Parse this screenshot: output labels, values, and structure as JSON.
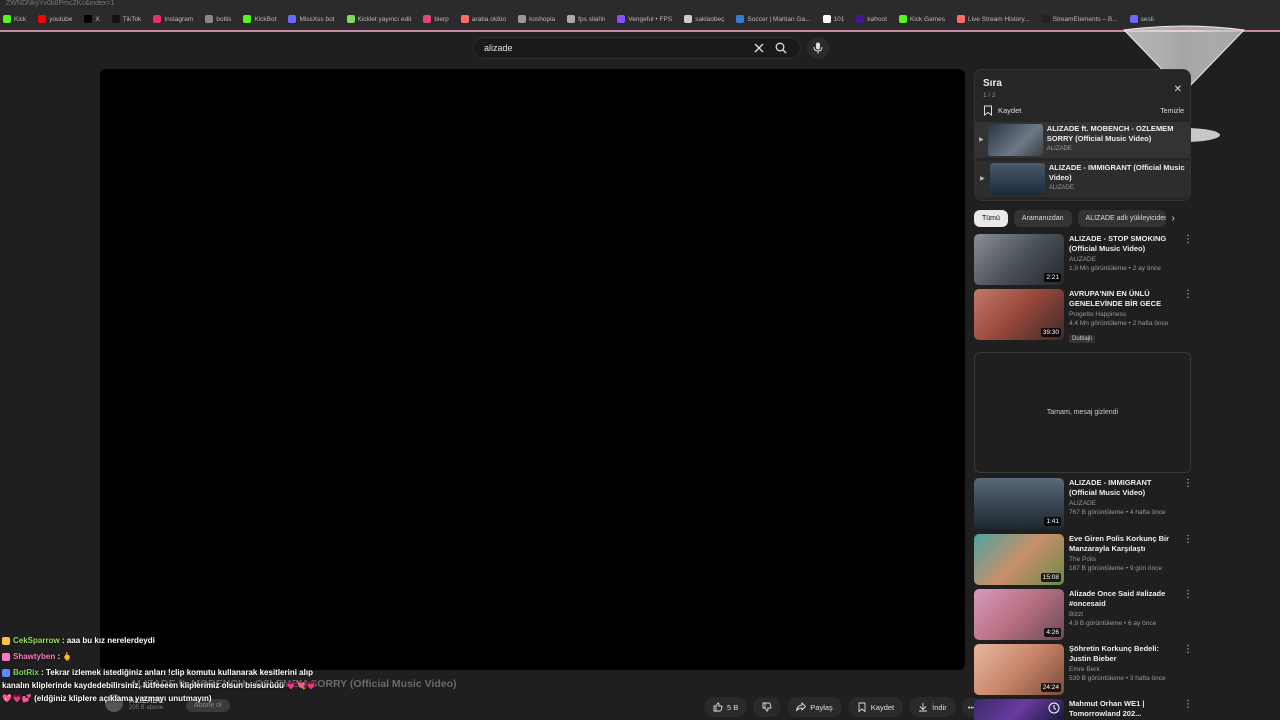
{
  "browser": {
    "url_fragment": "ZWNDNkyYv0b8PmcZKc&index=1",
    "bookmarks": [
      {
        "label": "Kick",
        "color": "#53fc18"
      },
      {
        "label": "youtube",
        "color": "#ff0000"
      },
      {
        "label": "X",
        "color": "#000000"
      },
      {
        "label": "TikTok",
        "color": "#111111"
      },
      {
        "label": "Instagram",
        "color": "#e1306c"
      },
      {
        "label": "botlis",
        "color": "#888888"
      },
      {
        "label": "KickBot",
        "color": "#53fc18"
      },
      {
        "label": "MissXss bot",
        "color": "#6a6aff"
      },
      {
        "label": "Kicklet yayıncı edit",
        "color": "#7ddc5c"
      },
      {
        "label": "bierp",
        "color": "#e0457b"
      },
      {
        "label": "araba oldüo",
        "color": "#ff6b6b"
      },
      {
        "label": "koshopia",
        "color": "#999999"
      },
      {
        "label": "fps silahlı",
        "color": "#aaaaaa"
      },
      {
        "label": "Vengeful • FPS",
        "color": "#8a4fff"
      },
      {
        "label": "saklaobeç",
        "color": "#cccccc"
      },
      {
        "label": "Soccer | Martian Ga...",
        "color": "#3a7bd5"
      },
      {
        "label": "101",
        "color": "#ffffff"
      },
      {
        "label": "kahoot",
        "color": "#46178f"
      },
      {
        "label": "Kick Games",
        "color": "#53fc18"
      },
      {
        "label": "Live Stream History...",
        "color": "#ff6b6b"
      },
      {
        "label": "StreamElements – B...",
        "color": "#222222"
      },
      {
        "label": "sesli",
        "color": "#6a6aff"
      }
    ]
  },
  "search": {
    "value": "alizade"
  },
  "video": {
    "title": "ALIZADE ft. MOBENCH - OZLEMEM SORRY (Official Music Video)",
    "channel": "ALIZADE",
    "subscribers": "205 B abone",
    "subscribe_label": "Abone ol",
    "likes": "5 B",
    "share_label": "Paylaş",
    "save_label": "Kaydet",
    "download_label": "İndir"
  },
  "chat": {
    "messages": [
      {
        "user": "CekSparrow",
        "text": ": aaa bu kız nerelerdeydi"
      },
      {
        "user": "Shawtyben",
        "text": ": 🖕"
      },
      {
        "user": "BotRix",
        "text": ": Tekrar izlemek istediğiniz anları !clip komutu kullanarak kesitlerini alıp kanalın kliplerinde kaydedebilirsiniz, lütfeeeen kliplerimiz olsun bissürüüü 💗💘💗💖💗💕 (eldğiniz kliplere açıklama yazmayı unutmayın)"
      }
    ]
  },
  "queue": {
    "title": "Sıra",
    "count": "1 / 2",
    "save_label": "Kaydet",
    "clear_label": "Temizle",
    "items": [
      {
        "title": "ALIZADE ft. MOBENCH - OZLEMEM SORRY (Official Music Video)",
        "channel": "ALIZADE"
      },
      {
        "title": "ALIZADE - IMMIGRANT (Official Music Video)",
        "channel": "ALIZADE"
      }
    ]
  },
  "chips": [
    "Tümü",
    "Aramanızdan",
    "ALIZADE adlı yükleyiciden"
  ],
  "hidden_message": "Tamam, mesaj gizlendi",
  "recommendations": [
    {
      "title": "ALIZADE - STOP SMOKING (Official Music Video)",
      "channel": "ALIZADE",
      "stats": "1,9 Mn görüntüleme • 2 ay önce",
      "duration": "2:21",
      "tag": ""
    },
    {
      "title": "AVRUPA'NIN EN ÜNLÜ GENELEVİNDE BİR GECE",
      "channel": "Progetto Happiness",
      "stats": "4,4 Mn görüntüleme • 2 hafta önce",
      "duration": "39:30",
      "tag": "Dublajlı"
    },
    {
      "title": "ALIZADE - IMMIGRANT (Official Music Video)",
      "channel": "ALIZADE",
      "stats": "767 B görüntüleme • 4 hafta önce",
      "duration": "1:41",
      "tag": ""
    },
    {
      "title": "Eve Giren Polis Korkunç Bir Manzarayla Karşılaştı",
      "channel": "The Polis",
      "stats": "187 B görüntüleme • 9 gün önce",
      "duration": "15:08",
      "tag": ""
    },
    {
      "title": "Alizade Once Said #alizade #oncesaid",
      "channel": "Bizzt",
      "stats": "4,9 B görüntüleme • 6 ay önce",
      "duration": "4:26",
      "tag": ""
    },
    {
      "title": "Şöhretin Korkunç Bedeli: Justin Bieber",
      "channel": "Emre Berk",
      "stats": "539 B görüntüleme • 3 hafta önce",
      "duration": "24:24",
      "tag": ""
    },
    {
      "title": "Mahmut Orhan WE1 | Tomorrowland 202...",
      "channel": "",
      "stats": "",
      "duration": "",
      "tag": ""
    }
  ]
}
